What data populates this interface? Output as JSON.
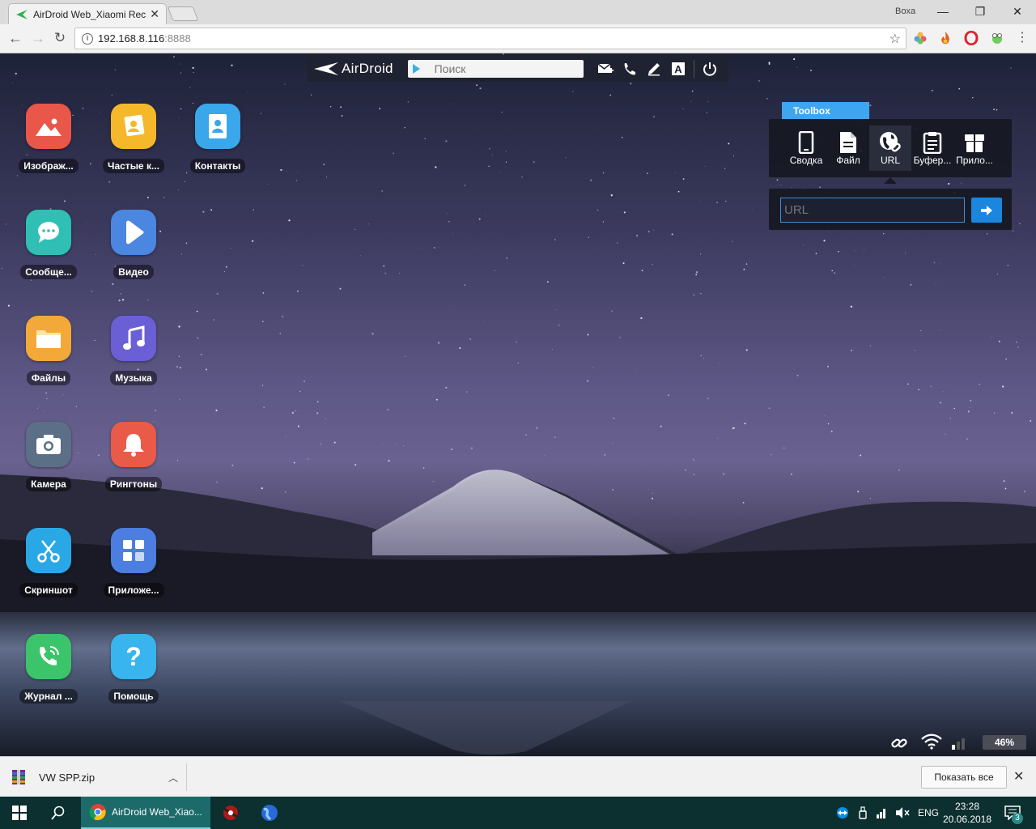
{
  "browser": {
    "tab_title": "AirDroid Web_Xiaomi Rec",
    "profile_name": "Boxa",
    "url_host": "192.168.8.116",
    "url_port": ":8888"
  },
  "airdroid": {
    "logo_text": "AirDroid",
    "search_placeholder": "Поиск",
    "apps": [
      {
        "label": "Изображ...",
        "icon": "gallery-icon",
        "color": "#e8574a"
      },
      {
        "label": "Частые к...",
        "icon": "frequent-contacts-icon",
        "color": "#f5b82a"
      },
      {
        "label": "Контакты",
        "icon": "contacts-icon",
        "color": "#3aa7ea"
      },
      {
        "label": "Сообще...",
        "icon": "messages-icon",
        "color": "#2fbfb5"
      },
      {
        "label": "Видео",
        "icon": "video-icon",
        "color": "#4b86e0"
      },
      {
        "label": "Файлы",
        "icon": "files-icon",
        "color": "#f2a93a"
      },
      {
        "label": "Музыка",
        "icon": "music-icon",
        "color": "#6b5fd6"
      },
      {
        "label": "Камера",
        "icon": "camera-icon",
        "color": "#5b6f86"
      },
      {
        "label": "Рингтоны",
        "icon": "ringtones-icon",
        "color": "#ea5a48"
      },
      {
        "label": "Скриншот",
        "icon": "screenshot-icon",
        "color": "#2aa8e6"
      },
      {
        "label": "Приложе...",
        "icon": "apps-icon",
        "color": "#4c7de0"
      },
      {
        "label": "Журнал ...",
        "icon": "call-log-icon",
        "color": "#3cc46a"
      },
      {
        "label": "Помощь",
        "icon": "help-icon",
        "color": "#38b4ee"
      }
    ],
    "toolbox": {
      "tab_label": "Toolbox",
      "items": [
        {
          "label": "Сводка",
          "icon": "phone-summary-icon"
        },
        {
          "label": "Файл",
          "icon": "file-icon"
        },
        {
          "label": "URL",
          "icon": "globe-link-icon"
        },
        {
          "label": "Буфер...",
          "icon": "clipboard-icon"
        },
        {
          "label": "Прило...",
          "icon": "app-box-icon"
        }
      ],
      "selected": "URL",
      "url_placeholder": "URL"
    },
    "status": {
      "battery": "46%"
    }
  },
  "downloads": {
    "file_name": "VW SPP.zip",
    "show_all": "Показать все"
  },
  "taskbar": {
    "active_task": "AirDroid Web_Xiao...",
    "language": "ENG",
    "time": "23:28",
    "date": "20.06.2018",
    "notification_count": "3"
  }
}
